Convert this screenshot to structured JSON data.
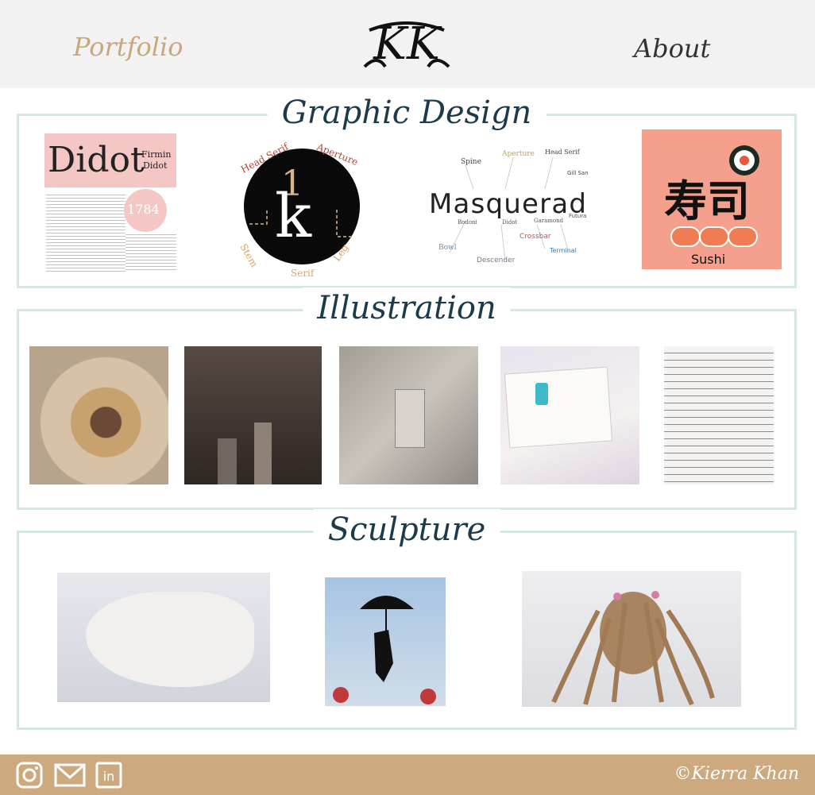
{
  "header": {
    "nav_left": "Portfolio",
    "nav_right": "About",
    "logo_text": "KK"
  },
  "sections": {
    "graphic": {
      "title": "Graphic Design",
      "didot": {
        "title": "Didot",
        "name_1": "Firmin",
        "name_2": "Didot",
        "year": "1784"
      },
      "anatomy": {
        "letter": "k",
        "digit": "1",
        "labels": [
          "Head Serif",
          "Aperture",
          "Stem",
          "Serif",
          "Leg"
        ]
      },
      "masquerade": {
        "word": "Masquerad",
        "labels": [
          "Spine",
          "Aperture",
          "Head Serif",
          "Gill Sans",
          "Crossbar",
          "Bowl",
          "Descender",
          "Terminal",
          "Bodoni",
          "Didot",
          "Garamond",
          "Futura"
        ]
      },
      "sushi": {
        "kanji": "寿司",
        "label": "Sushi"
      }
    },
    "illustration": {
      "title": "Illustration"
    },
    "sculpture": {
      "title": "Sculpture"
    }
  },
  "footer": {
    "copyright": "©Kierra Khan",
    "linkedin_text": "in"
  },
  "colors": {
    "header_bg": "#f2f2f2",
    "accent_gold": "#c9a77c",
    "footer_bg": "#cdaa7d",
    "section_border": "#d4e7e2",
    "title_color": "#1c3a4a"
  }
}
